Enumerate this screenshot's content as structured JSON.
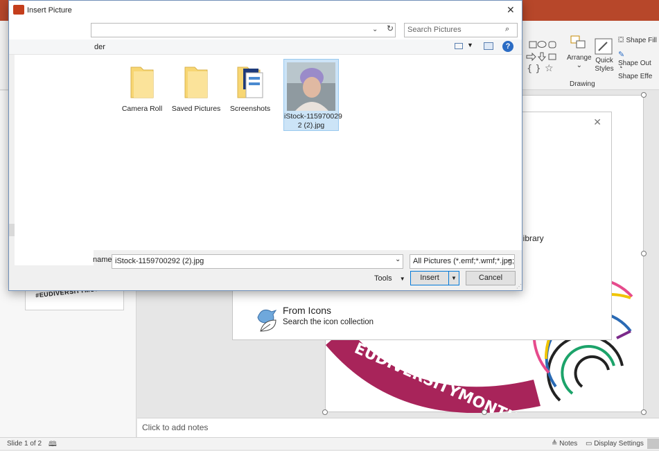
{
  "dialog": {
    "title": "Insert Picture",
    "nav_partial": "der",
    "search": {
      "placeholder": "Search Pictures"
    },
    "files": [
      {
        "name": "Camera Roll",
        "type": "folder"
      },
      {
        "name": "Saved Pictures",
        "type": "folder"
      },
      {
        "name": "Screenshots",
        "type": "folder"
      },
      {
        "name": "iStock-115970029\n2 (2).jpg",
        "type": "image"
      }
    ],
    "filename_label": "name:",
    "filename_value": "iStock-1159700292 (2).jpg",
    "filetype_value": "All Pictures (*.emf;*.wmf;*.jpg;*",
    "tools_label": "Tools",
    "insert_label": "Insert",
    "cancel_label": "Cancel"
  },
  "ribbon": {
    "arrange_label": "Arrange",
    "quick_styles_label": "Quick\nStyles",
    "shape_fill": "Shape Fill",
    "shape_outline": "Shape Out",
    "shape_effects": "Shape Effe",
    "group_label": "Drawing"
  },
  "stock_panel": {
    "library_text": "e library",
    "from_icons_title": "From Icons",
    "from_icons_sub": "Search the icon collection"
  },
  "slide": {
    "banner_text": "EUDIVERSITYMONTH",
    "thumb_text": "#EUDIVERSITYMONTH"
  },
  "notes": {
    "placeholder": "Click to add notes"
  },
  "status": {
    "slide_info": "Slide 1 of 2",
    "notes_label": "Notes",
    "display_settings": "Display Settings"
  },
  "colors": {
    "accent": "#b7472a",
    "banner": "#a8245a"
  }
}
